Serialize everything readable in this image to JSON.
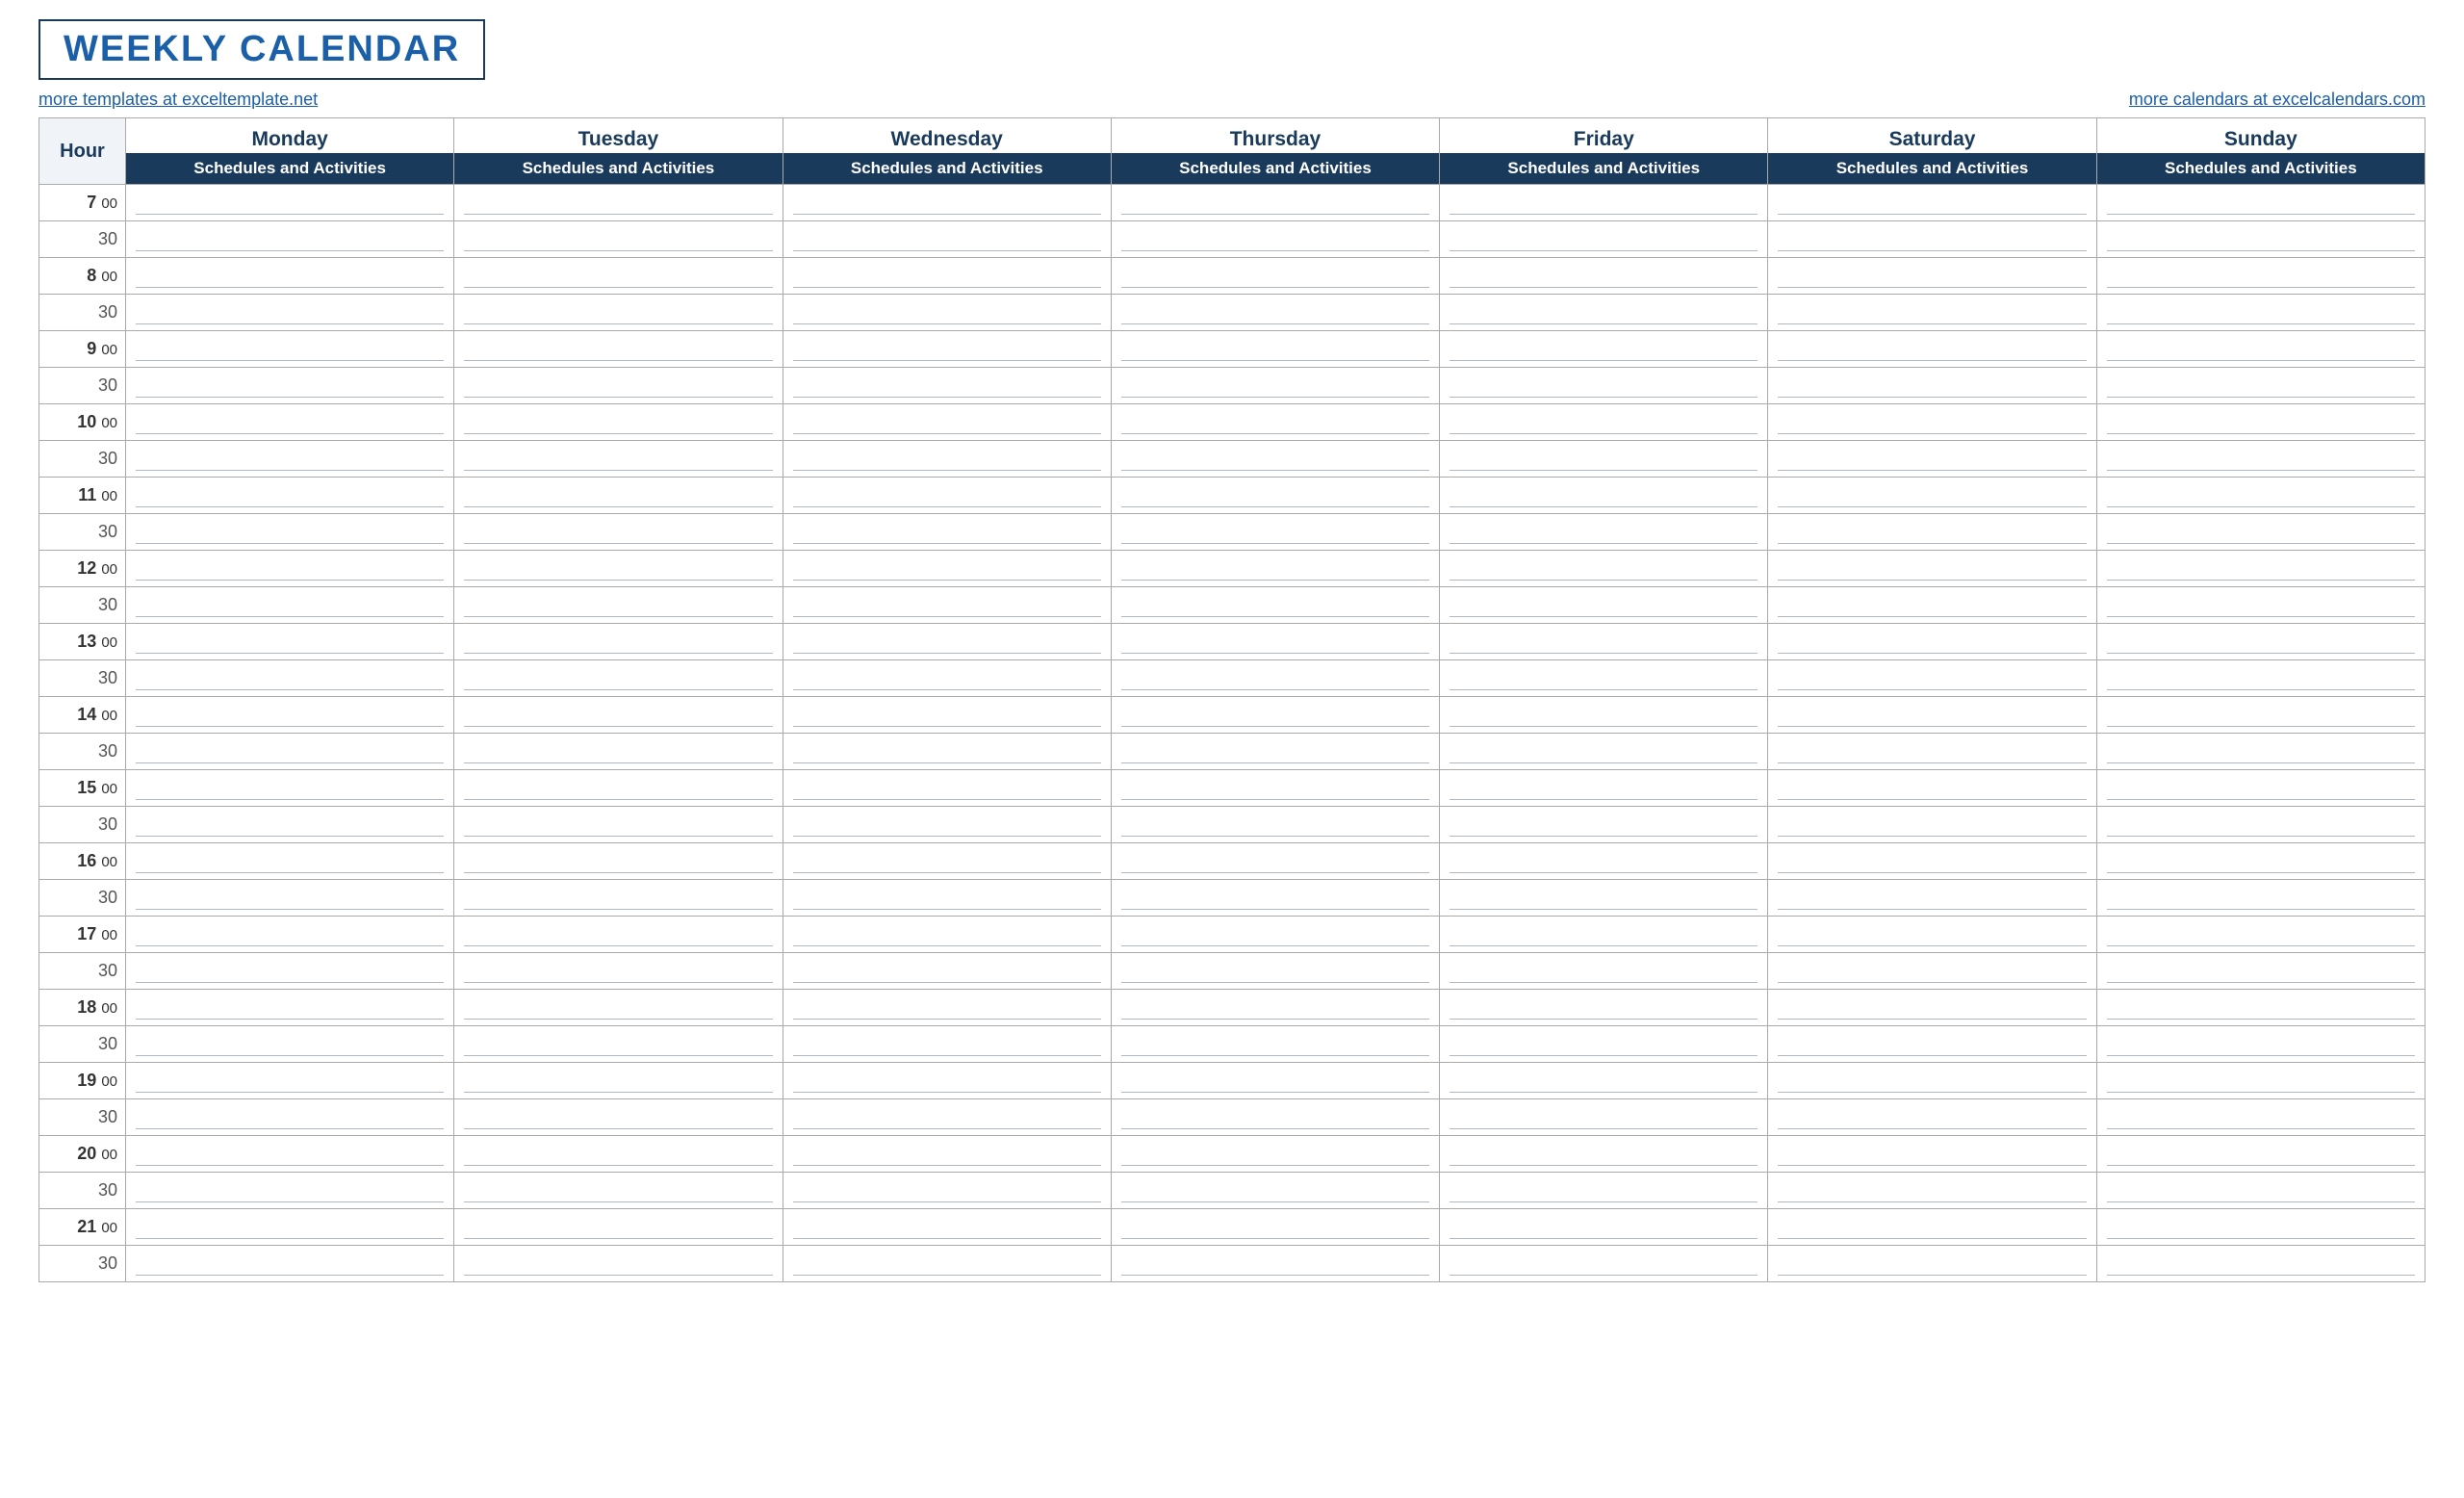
{
  "title": "WEEKLY CALENDAR",
  "link_left": "more templates at exceltemplate.net",
  "link_right": "more calendars at excelcalendars.com",
  "hour_header": "Hour",
  "days": [
    "Monday",
    "Tuesday",
    "Wednesday",
    "Thursday",
    "Friday",
    "Saturday",
    "Sunday"
  ],
  "sub_header_label": "Schedules and Activities",
  "hours": [
    {
      "hour": "7",
      "min": "00"
    },
    {
      "hour": "",
      "min": "30"
    },
    {
      "hour": "8",
      "min": "00"
    },
    {
      "hour": "",
      "min": "30"
    },
    {
      "hour": "9",
      "min": "00"
    },
    {
      "hour": "",
      "min": "30"
    },
    {
      "hour": "10",
      "min": "00"
    },
    {
      "hour": "",
      "min": "30"
    },
    {
      "hour": "11",
      "min": "00"
    },
    {
      "hour": "",
      "min": "30"
    },
    {
      "hour": "12",
      "min": "00"
    },
    {
      "hour": "",
      "min": "30"
    },
    {
      "hour": "13",
      "min": "00"
    },
    {
      "hour": "",
      "min": "30"
    },
    {
      "hour": "14",
      "min": "00"
    },
    {
      "hour": "",
      "min": "30"
    },
    {
      "hour": "15",
      "min": "00"
    },
    {
      "hour": "",
      "min": "30"
    },
    {
      "hour": "16",
      "min": "00"
    },
    {
      "hour": "",
      "min": "30"
    },
    {
      "hour": "17",
      "min": "00"
    },
    {
      "hour": "",
      "min": "30"
    },
    {
      "hour": "18",
      "min": "00"
    },
    {
      "hour": "",
      "min": "30"
    },
    {
      "hour": "19",
      "min": "00"
    },
    {
      "hour": "",
      "min": "30"
    },
    {
      "hour": "20",
      "min": "00"
    },
    {
      "hour": "",
      "min": "30"
    },
    {
      "hour": "21",
      "min": "00"
    },
    {
      "hour": "",
      "min": "30"
    }
  ]
}
